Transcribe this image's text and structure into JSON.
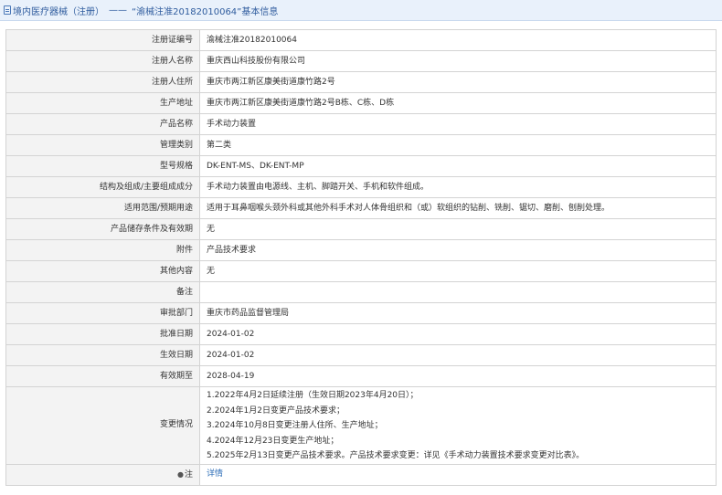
{
  "header": {
    "section": "境内医疗器械（注册）",
    "separator": "——",
    "title": "“渝械注准20182010064”基本信息"
  },
  "rows": [
    {
      "label": "注册证编号",
      "value": "渝械注准20182010064"
    },
    {
      "label": "注册人名称",
      "value": "重庆西山科技股份有限公司"
    },
    {
      "label": "注册人住所",
      "value": "重庆市两江新区康美街道康竹路2号"
    },
    {
      "label": "生产地址",
      "value": "重庆市两江新区康美街道康竹路2号B栋、C栋、D栋"
    },
    {
      "label": "产品名称",
      "value": "手术动力装置"
    },
    {
      "label": "管理类别",
      "value": "第二类"
    },
    {
      "label": "型号规格",
      "value": "DK-ENT-MS、DK-ENT-MP"
    },
    {
      "label": "结构及组成/主要组成成分",
      "value": "手术动力装置由电源线、主机、脚踏开关、手机和软件组成。"
    },
    {
      "label": "适用范围/预期用途",
      "value": "适用于耳鼻咽喉头颈外科或其他外科手术对人体骨组织和（或）软组织的钻削、铣削、锯切、磨削、刨削处理。"
    },
    {
      "label": "产品储存条件及有效期",
      "value": "无"
    },
    {
      "label": "附件",
      "value": "产品技术要求"
    },
    {
      "label": "其他内容",
      "value": "无"
    },
    {
      "label": "备注",
      "value": ""
    },
    {
      "label": "审批部门",
      "value": "重庆市药品监督管理局"
    },
    {
      "label": "批准日期",
      "value": "2024-01-02"
    },
    {
      "label": "生效日期",
      "value": "2024-01-02"
    },
    {
      "label": "有效期至",
      "value": "2028-04-19"
    }
  ],
  "changes": {
    "label": "变更情况",
    "lines": [
      "1.2022年4月2日延续注册（生效日期2023年4月20日）；",
      "2.2024年1月2日变更产品技术要求；",
      "3.2024年10月8日变更注册人住所、生产地址；",
      "4.2024年12月23日变更生产地址；",
      "5.2025年2月13日变更产品技术要求。产品技术要求变更：详见《手术动力装置技术要求变更对比表》。"
    ]
  },
  "note_row": {
    "label": "注",
    "link_text": "详情",
    "icon": "bulb-icon"
  },
  "colors": {
    "header_bg": "#e9f1fb",
    "header_text": "#2f5c9e",
    "label_bg": "#f3f3f3",
    "border": "#d3d3d3",
    "link": "#2f6fb8"
  }
}
